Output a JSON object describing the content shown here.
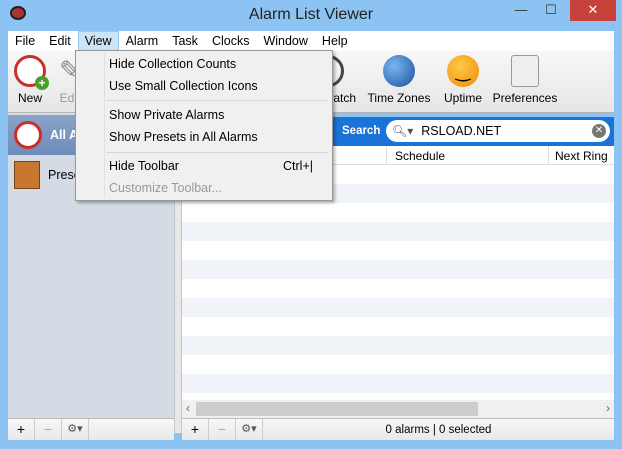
{
  "window": {
    "title": "Alarm List Viewer",
    "minimize": "—",
    "maximize": "☐",
    "close": "✕"
  },
  "menubar": [
    "File",
    "Edit",
    "View",
    "Alarm",
    "Task",
    "Clocks",
    "Window",
    "Help"
  ],
  "view_menu": {
    "items": [
      {
        "label": "Hide Collection Counts",
        "shortcut": "",
        "disabled": false
      },
      {
        "label": "Use Small Collection Icons",
        "shortcut": "",
        "disabled": false
      },
      {
        "label": "Show Private Alarms",
        "shortcut": "",
        "disabled": false
      },
      {
        "label": "Show Presets in All Alarms",
        "shortcut": "",
        "disabled": false
      },
      {
        "label": "Hide Toolbar",
        "shortcut": "Ctrl+|",
        "disabled": false
      },
      {
        "label": "Customize Toolbar...",
        "shortcut": "",
        "disabled": true
      }
    ]
  },
  "toolbar": {
    "new": "New",
    "edit": "Edit",
    "stopwatch": "Stopwatch",
    "time_zones": "Time Zones",
    "uptime": "Uptime",
    "preferences": "Preferences"
  },
  "sidebar": {
    "items": [
      {
        "label": "All Alarms",
        "selected": true
      },
      {
        "label": "Presets",
        "selected": false
      }
    ]
  },
  "search": {
    "label": "Search",
    "value": "RSLOAD.NET"
  },
  "table": {
    "columns": [
      "Schedule",
      "Next Ring"
    ]
  },
  "bottom": {
    "add": "+",
    "remove": "−",
    "gear": "⚙▾",
    "status": "0 alarms | 0 selected"
  }
}
